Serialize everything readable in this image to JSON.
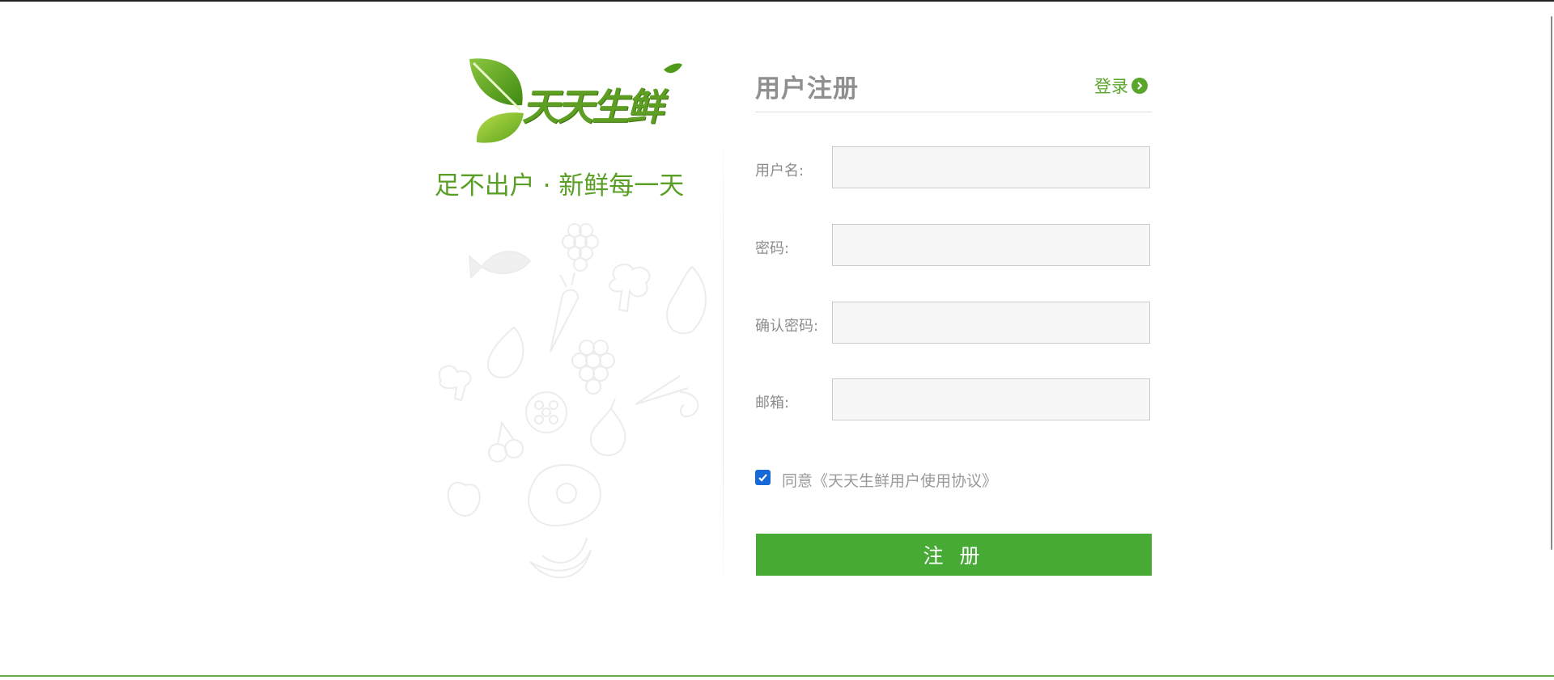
{
  "brand": {
    "logo_text": "天天生鲜",
    "slogan": "足不出户 · 新鲜每一天"
  },
  "form": {
    "title": "用户注册",
    "login_link": "登录",
    "fields": [
      {
        "label": "用户名:",
        "value": "",
        "placeholder": ""
      },
      {
        "label": "密码:",
        "value": "",
        "placeholder": ""
      },
      {
        "label": "确认密码:",
        "value": "",
        "placeholder": ""
      },
      {
        "label": "邮箱:",
        "value": "",
        "placeholder": ""
      }
    ],
    "agree_checked": true,
    "agree_text": "同意《天天生鲜用户使用协议》",
    "submit_label": "注 册"
  },
  "colors": {
    "brand_green": "#5a9f25",
    "button_green": "#47aa35",
    "checkbox_blue": "#1769d8"
  }
}
